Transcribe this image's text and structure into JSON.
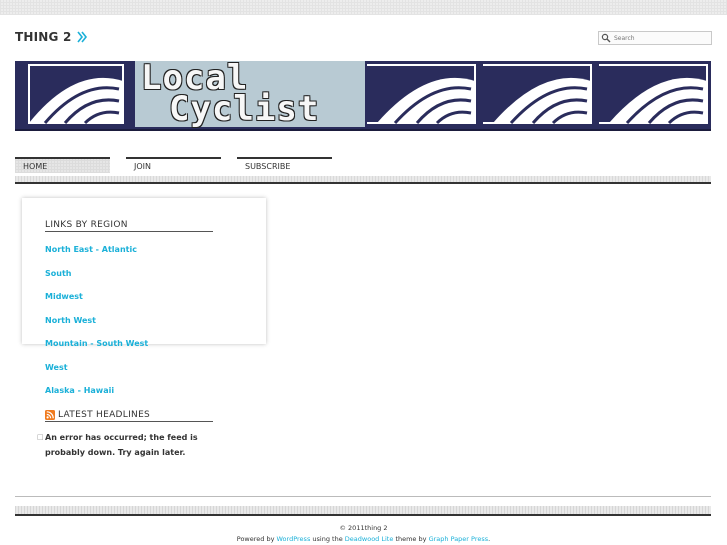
{
  "header": {
    "site_title": "THING 2",
    "search_placeholder": "Search"
  },
  "banner": {
    "line1": "Local",
    "line2": "Cyclist",
    "colors": {
      "navy": "#2a2c5c",
      "panel": "#b8cad3"
    }
  },
  "nav": {
    "items": [
      {
        "label": "HOME"
      },
      {
        "label": "JOIN"
      },
      {
        "label": "SUBSCRIBE"
      }
    ]
  },
  "sidebar": {
    "links_title": "LINKS BY REGION",
    "links": [
      {
        "label": "North East - Atlantic"
      },
      {
        "label": "South"
      },
      {
        "label": "Midwest"
      },
      {
        "label": "North West"
      },
      {
        "label": "Mountain - South West"
      },
      {
        "label": "West"
      },
      {
        "label": "Alaska - Hawaii"
      }
    ],
    "headlines_title": "LATEST HEADLINES",
    "feed_error": "An error has occurred; the feed is probably down. Try again later."
  },
  "footer": {
    "copyright": "© 2011thing 2",
    "powered_prefix": "Powered by",
    "wordpress": "WordPress",
    "using_the": "using the",
    "theme_name": "Deadwood Lite",
    "theme_by": "theme by",
    "author": "Graph Paper Press",
    "end": "."
  },
  "colors": {
    "link": "#1ab0d8",
    "text": "#333333"
  }
}
